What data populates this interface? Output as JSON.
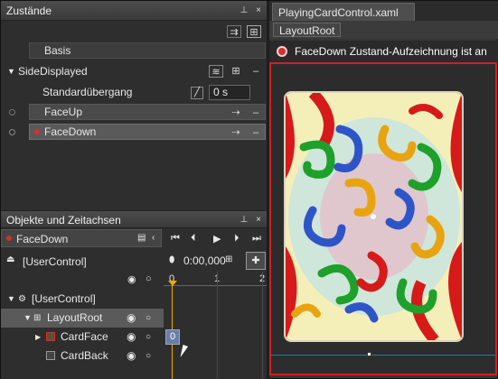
{
  "states_panel": {
    "title": "Zustände",
    "base_label": "Basis",
    "group_name": "SideDisplayed",
    "default_transition_label": "Standardübergang",
    "default_transition_value": "0 s",
    "states": [
      {
        "name": "FaceUp"
      },
      {
        "name": "FaceDown"
      }
    ]
  },
  "objects_panel": {
    "title": "Objekte und Zeitachsen",
    "storyboard": "FaceDown",
    "scope": "[UserControl]",
    "time": "0:00,000",
    "ruler_ticks": [
      "0",
      "1",
      "2"
    ],
    "tree": [
      {
        "label": "[UserControl]"
      },
      {
        "label": "LayoutRoot"
      },
      {
        "label": "CardFace"
      },
      {
        "label": "CardBack"
      }
    ]
  },
  "document": {
    "tab_title": "PlayingCardControl.xaml",
    "breadcrumb": "LayoutRoot",
    "recording_text": "FaceDown Zustand-Aufzeichnung ist an"
  },
  "colors": {
    "recording_border": "#cc2222",
    "accent": "#f2a900"
  }
}
